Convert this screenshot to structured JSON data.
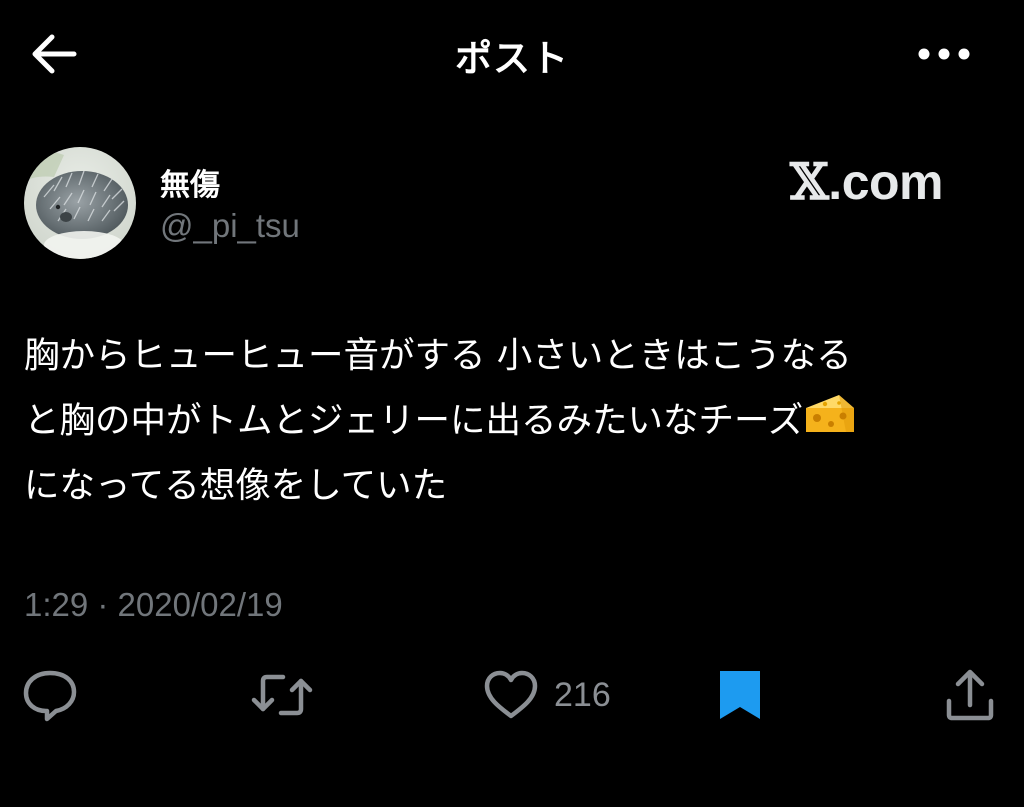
{
  "header": {
    "title": "ポスト",
    "back_icon": "arrow-left-icon",
    "more_icon": "more-horizontal-icon"
  },
  "author": {
    "display_name": "無傷",
    "handle": "@_pi_tsu",
    "avatar_icon": "hedgehog-avatar"
  },
  "watermark": {
    "x_glyph": "𝕏",
    "domain": ".com"
  },
  "tweet": {
    "lines": [
      "胸からヒューヒュー音がする 小さいときはこうなる",
      "と胸の中がトムとジェリーに出るみたいなチーズ",
      "になってる想像をしていた"
    ],
    "emoji": "cheese-wedge-icon"
  },
  "meta": {
    "timestamp": "1:29 · 2020/02/19"
  },
  "actions": {
    "reply_icon": "reply-icon",
    "repost_icon": "repost-icon",
    "like_icon": "heart-icon",
    "like_count": "216",
    "bookmark_icon": "bookmark-icon",
    "share_icon": "share-icon"
  },
  "colors": {
    "background": "#000000",
    "text_primary": "#ffffff",
    "text_secondary": "#71767b",
    "bookmark_active": "#1d9bf0",
    "cheese": "#f5b21b"
  }
}
